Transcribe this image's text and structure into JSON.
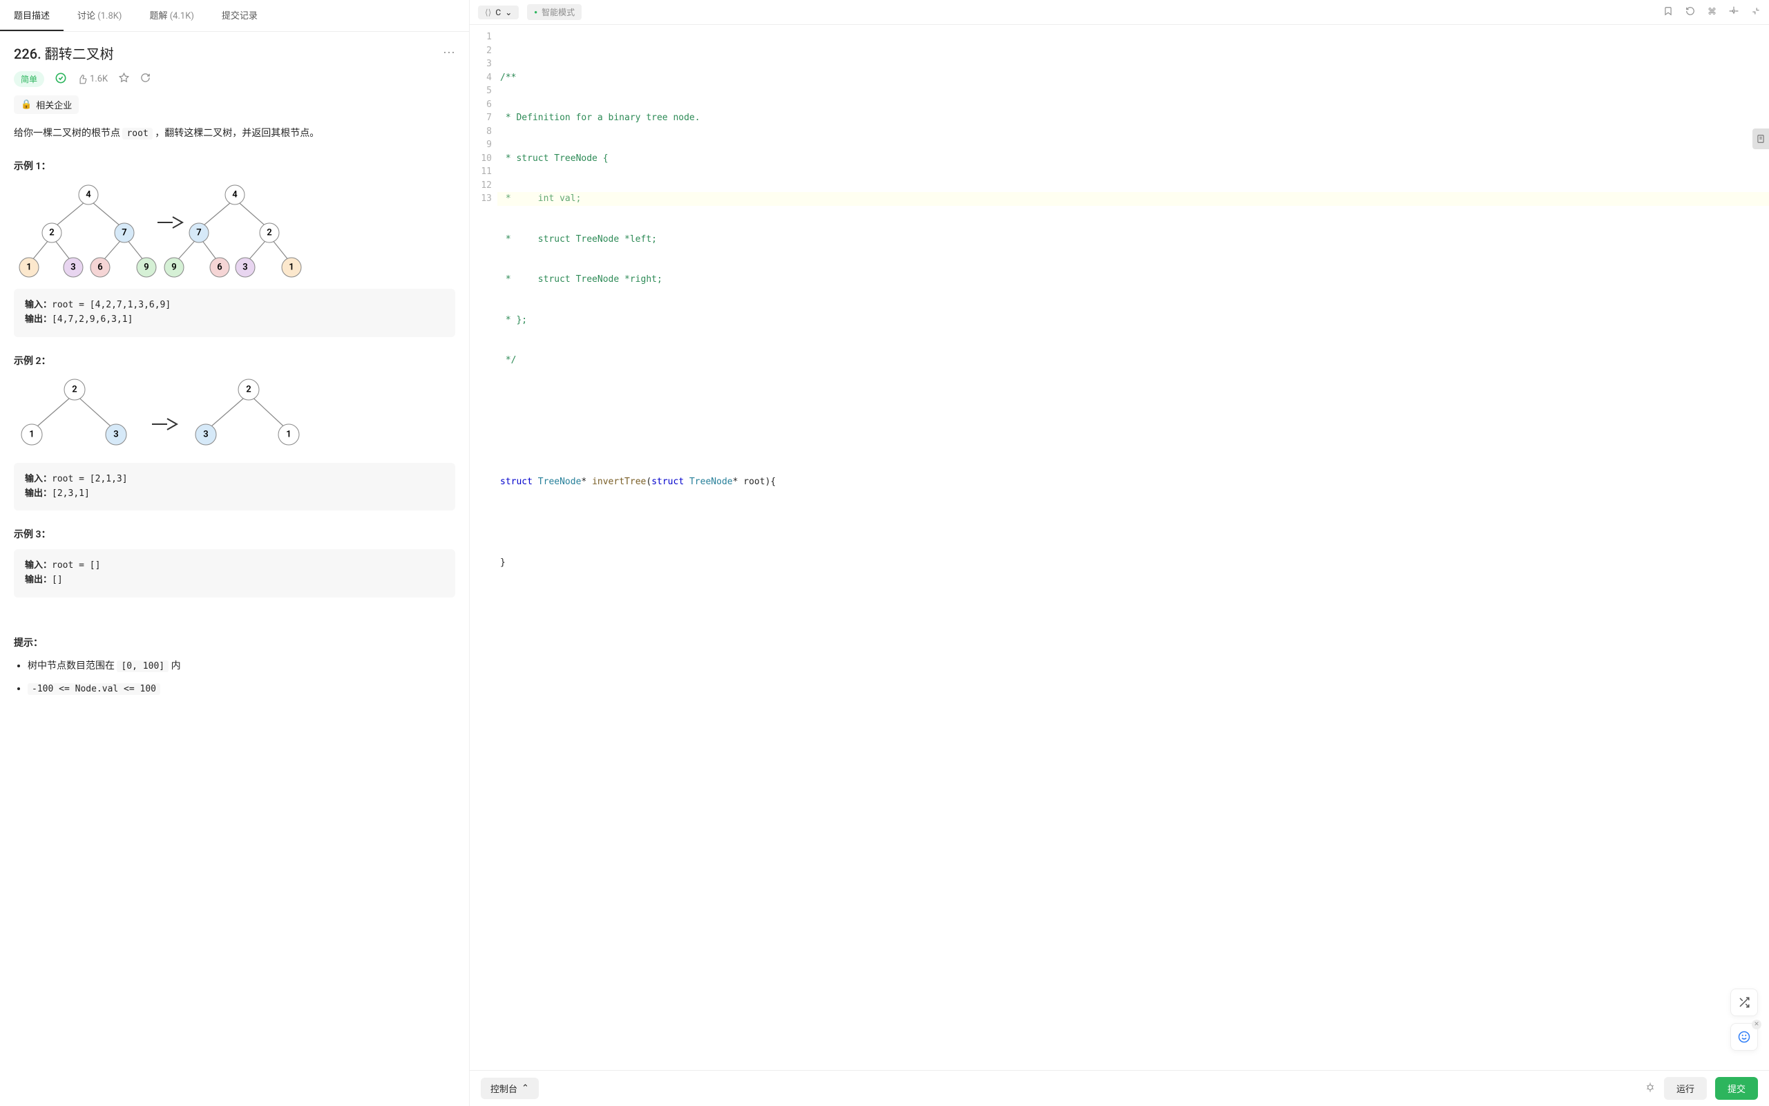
{
  "tabs": {
    "description": "题目描述",
    "discuss": "讨论",
    "discuss_count": "(1.8K)",
    "solution": "题解",
    "solution_count": "(4.1K)",
    "submission": "提交记录"
  },
  "problem": {
    "title": "226. 翻转二叉树",
    "difficulty": "简单",
    "likes": "1.6K",
    "company_tag": "相关企业",
    "description_pre": "给你一棵二叉树的根节点 ",
    "description_code": "root",
    "description_post": " ，翻转这棵二叉树，并返回其根节点。",
    "example1_title": "示例 1：",
    "example1_input_label": "输入：",
    "example1_input": "root = [4,2,7,1,3,6,9]",
    "example1_output_label": "输出：",
    "example1_output": "[4,7,2,9,6,3,1]",
    "example2_title": "示例 2：",
    "example2_input_label": "输入：",
    "example2_input": "root = [2,1,3]",
    "example2_output_label": "输出：",
    "example2_output": "[2,3,1]",
    "example3_title": "示例 3：",
    "example3_input_label": "输入：",
    "example3_input": "root = []",
    "example3_output_label": "输出：",
    "example3_output": "[]",
    "hints_title": "提示：",
    "hint1_pre": "树中节点数目范围在 ",
    "hint1_code": "[0, 100]",
    "hint1_post": " 内",
    "hint2_code": "-100 <= Node.val <= 100"
  },
  "editor": {
    "language": "C",
    "smart_mode": "智能模式",
    "lines": [
      "/**",
      " * Definition for a binary tree node.",
      " * struct TreeNode {",
      " *     int val;",
      " *     struct TreeNode *left;",
      " *     struct TreeNode *right;",
      " * };",
      " */",
      "",
      "",
      "struct TreeNode* invertTree(struct TreeNode* root){",
      "",
      "}"
    ]
  },
  "footer": {
    "console": "控制台",
    "run": "运行",
    "submit": "提交"
  }
}
